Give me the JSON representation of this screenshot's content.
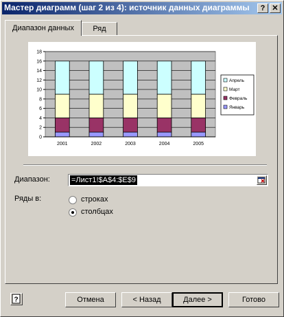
{
  "window": {
    "title": "Мастер диаграмм (шаг 2 из 4): источник данных диаграммы",
    "help_glyph": "?",
    "close_glyph": "✕"
  },
  "tabs": [
    {
      "label": "Диапазон данных",
      "active": true
    },
    {
      "label": "Ряд",
      "active": false
    }
  ],
  "range": {
    "label": "Диапазон:",
    "value": "=Лист1!$A$4:$E$9"
  },
  "series_in": {
    "label": "Ряды в:",
    "options": [
      {
        "label": "строках",
        "checked": false
      },
      {
        "label": "столбцах",
        "checked": true
      }
    ]
  },
  "buttons": {
    "cancel": "Отмена",
    "back": "< Назад",
    "next": "Далее >",
    "finish": "Готово",
    "help_glyph": "?"
  },
  "chart_data": {
    "type": "bar",
    "stacked": true,
    "categories": [
      "2001",
      "2002",
      "2003",
      "2004",
      "2005"
    ],
    "series": [
      {
        "name": "Январь",
        "values": [
          1,
          1,
          1,
          1,
          1
        ],
        "color": "#9999ff"
      },
      {
        "name": "Февраль",
        "values": [
          3,
          3,
          3,
          3,
          3
        ],
        "color": "#993366"
      },
      {
        "name": "Март",
        "values": [
          5,
          5,
          5,
          5,
          5
        ],
        "color": "#ffffcc"
      },
      {
        "name": "Апрель",
        "values": [
          7,
          7,
          7,
          7,
          7
        ],
        "color": "#ccffff"
      }
    ],
    "ylim": [
      0,
      18
    ],
    "yticks": [
      0,
      2,
      4,
      6,
      8,
      10,
      12,
      14,
      16,
      18
    ],
    "grid": true,
    "plot_bg": "#c0c0c0",
    "legend": "right",
    "legend_order": [
      "Апрель",
      "Март",
      "Февраль",
      "Январь"
    ]
  }
}
